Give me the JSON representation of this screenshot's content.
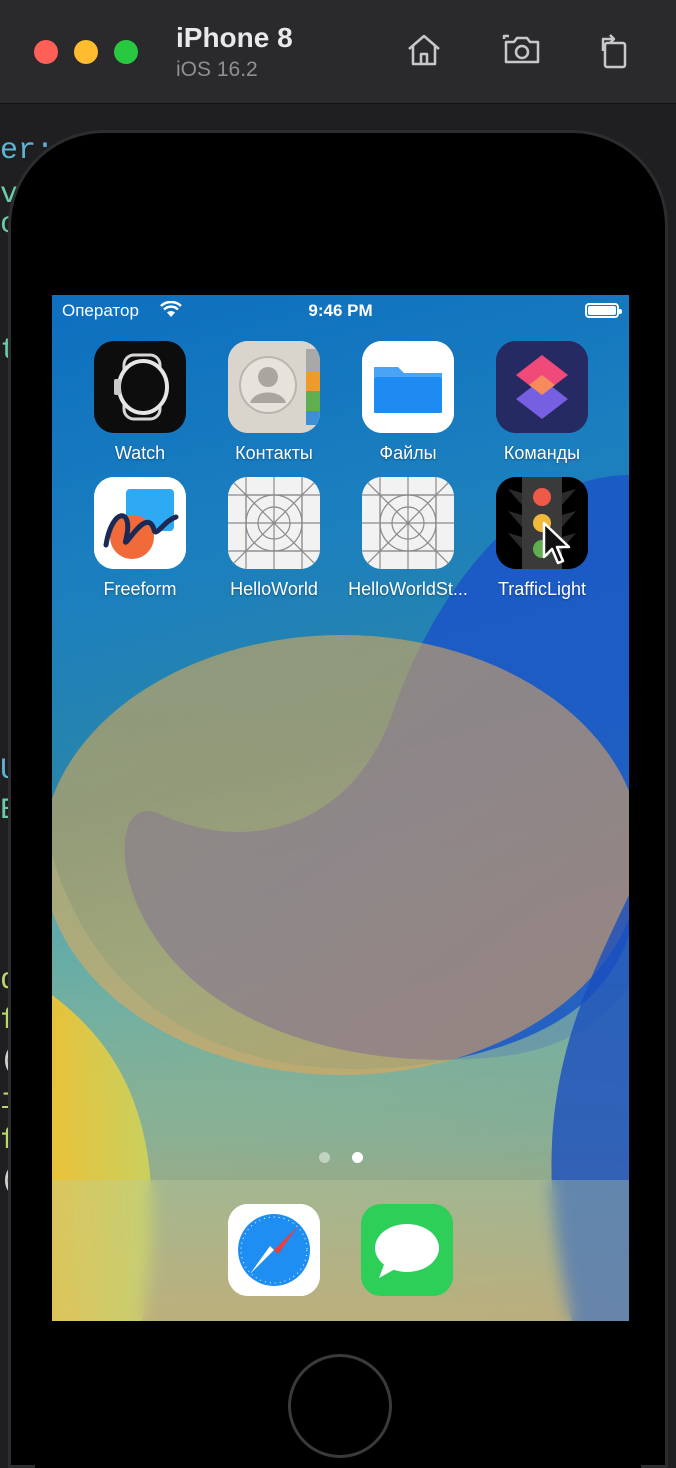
{
  "window": {
    "device_name": "iPhone 8",
    "os_version": "iOS 16.2",
    "toolbar": [
      {
        "name": "home-icon"
      },
      {
        "name": "screenshot-icon"
      },
      {
        "name": "rotate-icon"
      }
    ]
  },
  "status_bar": {
    "carrier": "Оператор",
    "time": "9:46 PM"
  },
  "home_screen": {
    "apps": [
      {
        "label": "Watch",
        "icon": "watch-icon"
      },
      {
        "label": "Контакты",
        "icon": "contacts-icon"
      },
      {
        "label": "Файлы",
        "icon": "files-icon"
      },
      {
        "label": "Команды",
        "icon": "shortcuts-icon"
      },
      {
        "label": "Freeform",
        "icon": "freeform-icon"
      },
      {
        "label": "HelloWorld",
        "icon": "placeholder-app-icon"
      },
      {
        "label": "HelloWorldSt...",
        "icon": "placeholder-app-icon"
      },
      {
        "label": "TrafficLight",
        "icon": "traffic-light-icon"
      }
    ],
    "page_count": 2,
    "current_page": 2,
    "dock": [
      {
        "icon": "safari-icon"
      },
      {
        "icon": "messages-icon"
      }
    ]
  },
  "colors": {
    "traffic_red": "#fe5f57",
    "traffic_yellow": "#febc2e",
    "traffic_green": "#28c840"
  }
}
